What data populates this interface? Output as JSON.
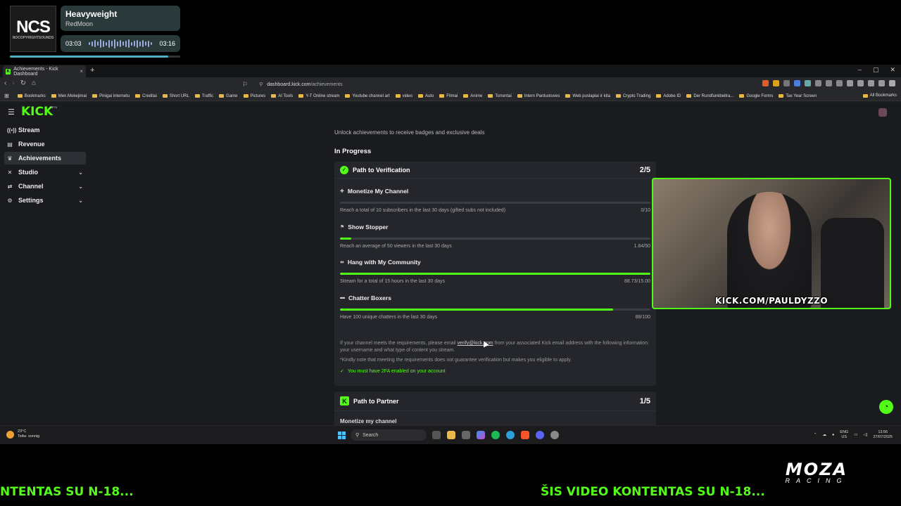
{
  "music": {
    "logo": "NCS",
    "logo_sub": "NOCOPYRIGHTSOUNDS",
    "title": "Heavyweight",
    "artist": "RedMoon",
    "elapsed": "03:03",
    "duration": "03:16",
    "progress": 0.93
  },
  "browser": {
    "tab_title": "Achievements - Kick Dashboard",
    "tab_close": "×",
    "new_tab": "+",
    "url_host": "dashboard.kick.com",
    "url_path": "/achievements",
    "bookmarks": [
      "Bookmarks",
      "Men.Mokejimai",
      "Pinigai internetu",
      "Creditai",
      "Short URL",
      "Traffic",
      "Game",
      "Pictures",
      "AI Tools",
      "Y-T Online stream",
      "Youtube channel art",
      "video",
      "Auto",
      "Filmai",
      "Anime",
      "Torrentai",
      "Intern Parduotuves",
      "Web puslapiai ir kita",
      "Crypto Trading",
      "Adobe ID",
      "Der Rundfunkbeitra...",
      "Google Forms",
      "Tax Year Screen"
    ],
    "all_bookmarks": "All Bookmarks",
    "win_controls": [
      "–",
      "▢",
      "✕"
    ]
  },
  "kick": {
    "logo": "KICK",
    "beta": "BETA",
    "sidebar": [
      {
        "label": "Stream",
        "icon": "stream-icon",
        "glyph": "((•))",
        "chevron": false,
        "active": false
      },
      {
        "label": "Revenue",
        "icon": "revenue-icon",
        "glyph": "▤",
        "chevron": false,
        "active": false
      },
      {
        "label": "Achievements",
        "icon": "trophy-icon",
        "glyph": "♛",
        "chevron": false,
        "active": true
      },
      {
        "label": "Studio",
        "icon": "studio-icon",
        "glyph": "✕",
        "chevron": true,
        "active": false
      },
      {
        "label": "Channel",
        "icon": "channel-icon",
        "glyph": "⇄",
        "chevron": true,
        "active": false
      },
      {
        "label": "Settings",
        "icon": "gear-icon",
        "glyph": "⚙",
        "chevron": true,
        "active": false
      }
    ],
    "intro": "Unlock achievements to receive badges and exclusive deals",
    "in_progress": "In Progress",
    "verification": {
      "title": "Path to Verification",
      "count": "2/5",
      "requirements": [
        {
          "title": "Monetize My Channel",
          "desc": "Reach a total of 10 subscribers in the last 30 days (gifted subs not included)",
          "value": "0/10",
          "progress": 0.0
        },
        {
          "title": "Show Stopper",
          "desc": "Reach an average of 50 viewers in the last 30 days",
          "value": "1.84/50",
          "progress": 0.037
        },
        {
          "title": "Hang with My Community",
          "desc": "Stream for a total of 15 hours in the last 30 days",
          "value": "88.73/15.00",
          "progress": 1.0
        },
        {
          "title": "Chatter Boxers",
          "desc": "Have 100 unique chatters in the last 30 days",
          "value": "88/100",
          "progress": 0.88
        }
      ],
      "note_pre": "If your channel meets the requirements, please email",
      "note_email": "verify@kick.com",
      "note_post": "from your associated Kick email address with the following information: your username and what type of content you stream.",
      "note2": "*Kindly note that meeting the requirements does not guarantee verification but makes you eligible to apply.",
      "twofa": "You must have 2FA enabled on your account"
    },
    "partner": {
      "title": "Path to Partner",
      "count": "1/5",
      "first_req": "Monetize my channel"
    }
  },
  "webcam": {
    "label": "KICK.COM/PAULDYZZO"
  },
  "taskbar": {
    "temp": "23°C",
    "weather": "Teilw. sonnig",
    "search": "Search",
    "lang_top": "ENG",
    "lang_bottom": "US",
    "time": "13:56",
    "date": "27/07/2025"
  },
  "ticker": {
    "left": "NTENTAS SU N-18...",
    "right": "ŠIS VIDEO KONTENTAS SU N-18..."
  },
  "sponsor": {
    "name": "MOZA",
    "sub": "RACING"
  }
}
